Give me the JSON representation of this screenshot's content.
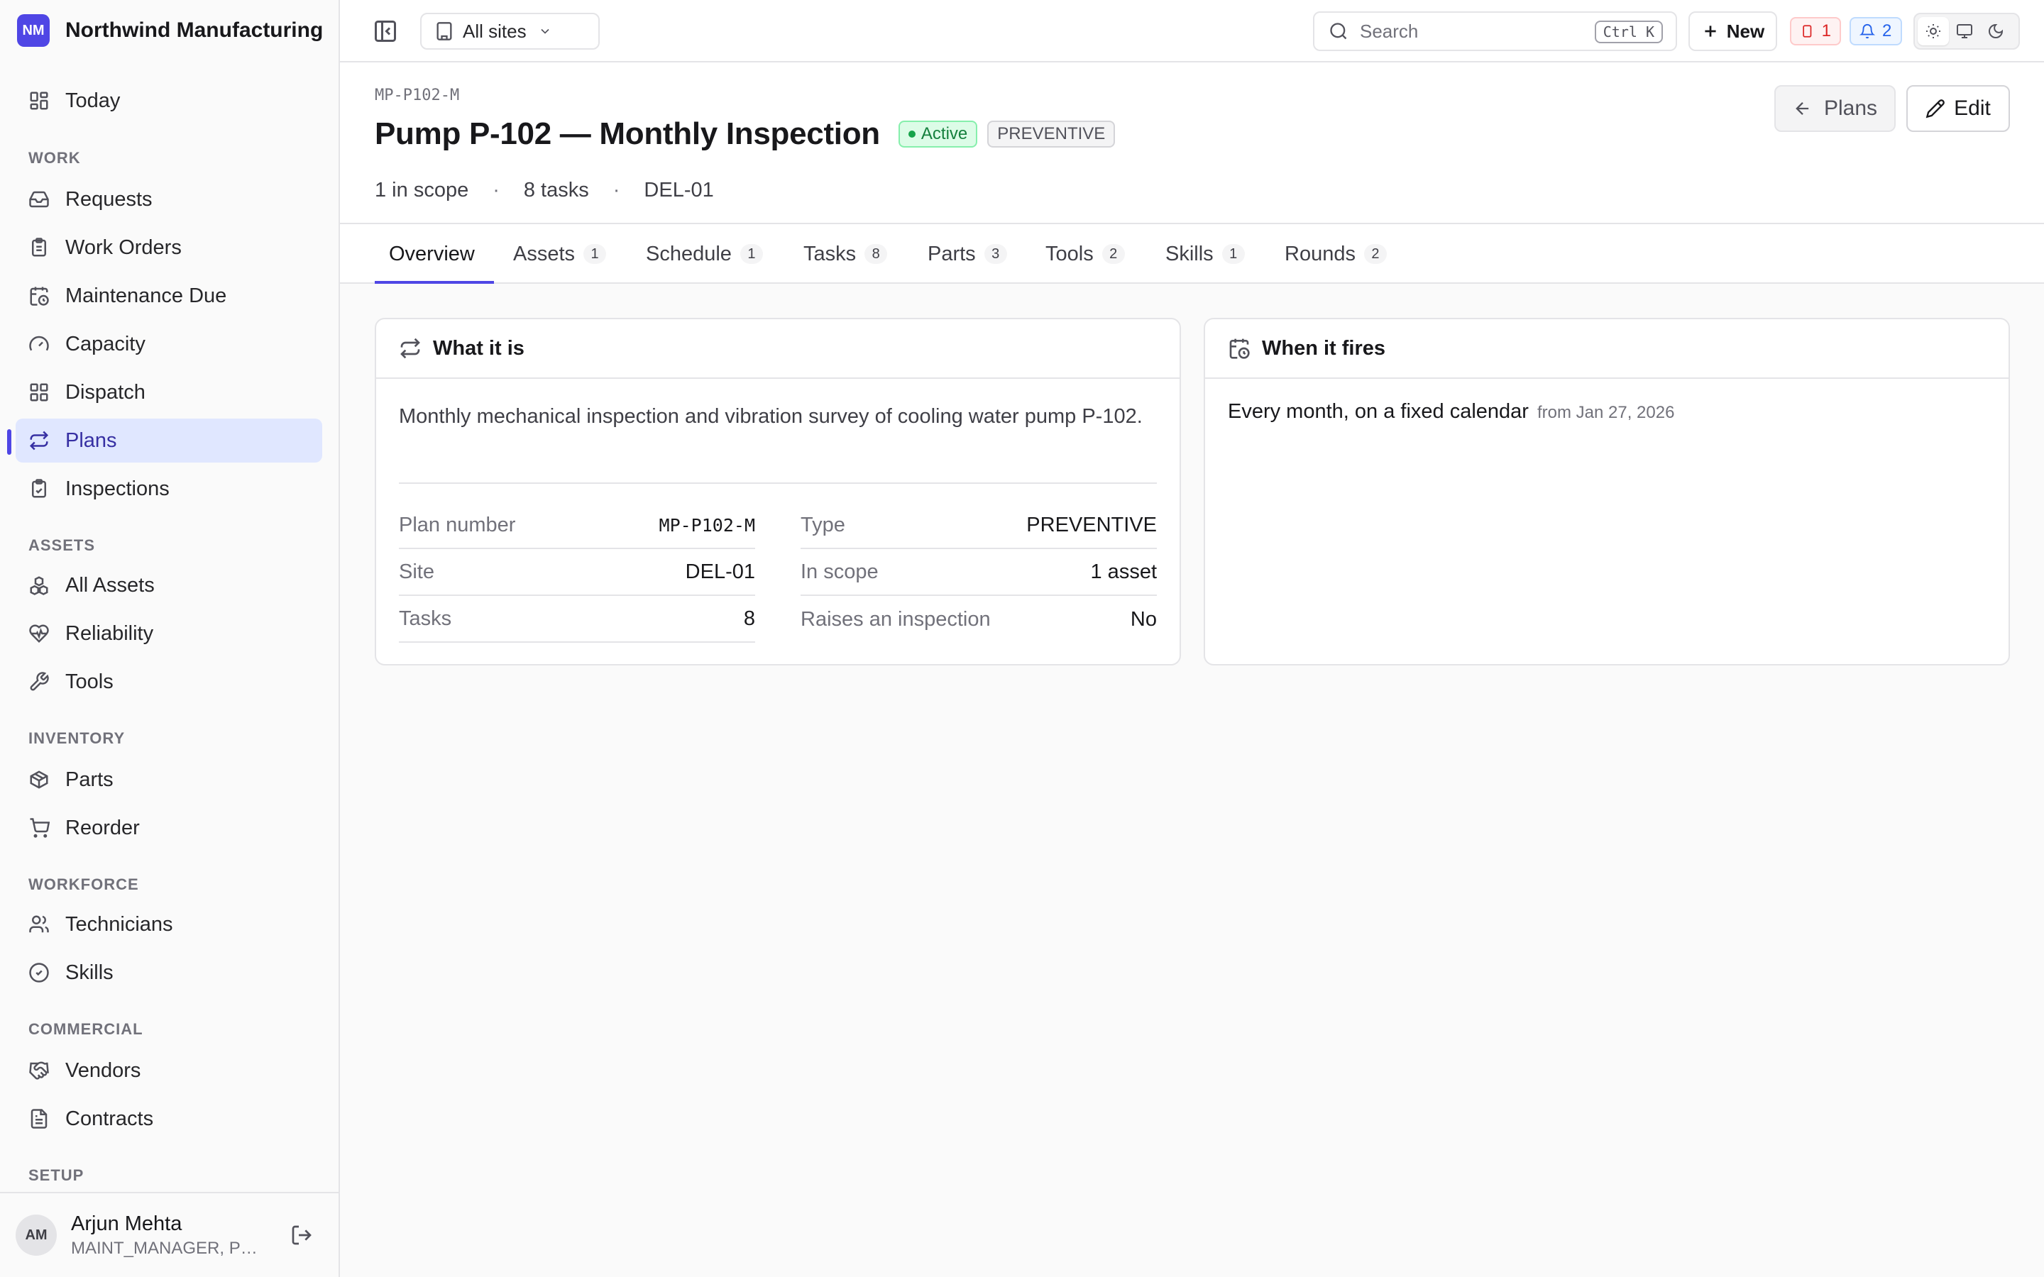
{
  "app": {
    "logo_initials": "NM",
    "name": "Northwind Manufacturing"
  },
  "nav": {
    "today": "Today",
    "sections": {
      "work": "WORK",
      "assets": "ASSETS",
      "inventory": "INVENTORY",
      "workforce": "WORKFORCE",
      "commercial": "COMMERCIAL",
      "setup": "SETUP"
    },
    "work": [
      "Requests",
      "Work Orders",
      "Maintenance Due",
      "Capacity",
      "Dispatch",
      "Plans",
      "Inspections"
    ],
    "assets": [
      "All Assets",
      "Reliability",
      "Tools"
    ],
    "inventory": [
      "Parts",
      "Reorder"
    ],
    "workforce": [
      "Technicians",
      "Skills"
    ],
    "commercial": [
      "Vendors",
      "Contracts"
    ],
    "active": "Plans"
  },
  "user": {
    "initials": "AM",
    "name": "Arjun Mehta",
    "role": "MAINT_MANAGER, PL..."
  },
  "topbar": {
    "site_select": "All sites",
    "search_placeholder": "Search",
    "search_shortcut": "Ctrl K",
    "new_label": "New",
    "alerts_count": "1",
    "notifications_count": "2"
  },
  "header": {
    "plan_code": "MP-P102-M",
    "title": "Pump P-102 — Monthly Inspection",
    "status": "Active",
    "type": "PREVENTIVE",
    "meta": [
      "1 in scope",
      "8 tasks",
      "DEL-01"
    ],
    "back_label": "Plans",
    "edit_label": "Edit"
  },
  "tabs": [
    {
      "label": "Overview",
      "count": ""
    },
    {
      "label": "Assets",
      "count": "1"
    },
    {
      "label": "Schedule",
      "count": "1"
    },
    {
      "label": "Tasks",
      "count": "8"
    },
    {
      "label": "Parts",
      "count": "3"
    },
    {
      "label": "Tools",
      "count": "2"
    },
    {
      "label": "Skills",
      "count": "1"
    },
    {
      "label": "Rounds",
      "count": "2"
    }
  ],
  "what_it_is": {
    "title": "What it is",
    "description": "Monthly mechanical inspection and vibration survey of cooling water pump P-102.",
    "fields": {
      "plan_number": {
        "label": "Plan number",
        "value": "MP-P102-M"
      },
      "site": {
        "label": "Site",
        "value": "DEL-01"
      },
      "tasks": {
        "label": "Tasks",
        "value": "8"
      },
      "type": {
        "label": "Type",
        "value": "PREVENTIVE"
      },
      "in_scope": {
        "label": "In scope",
        "value": "1 asset"
      },
      "raises_inspection": {
        "label": "Raises an inspection",
        "value": "No"
      }
    }
  },
  "when_it_fires": {
    "title": "When it fires",
    "schedule": "Every month, on a fixed calendar",
    "from": "from Jan 27, 2026"
  }
}
